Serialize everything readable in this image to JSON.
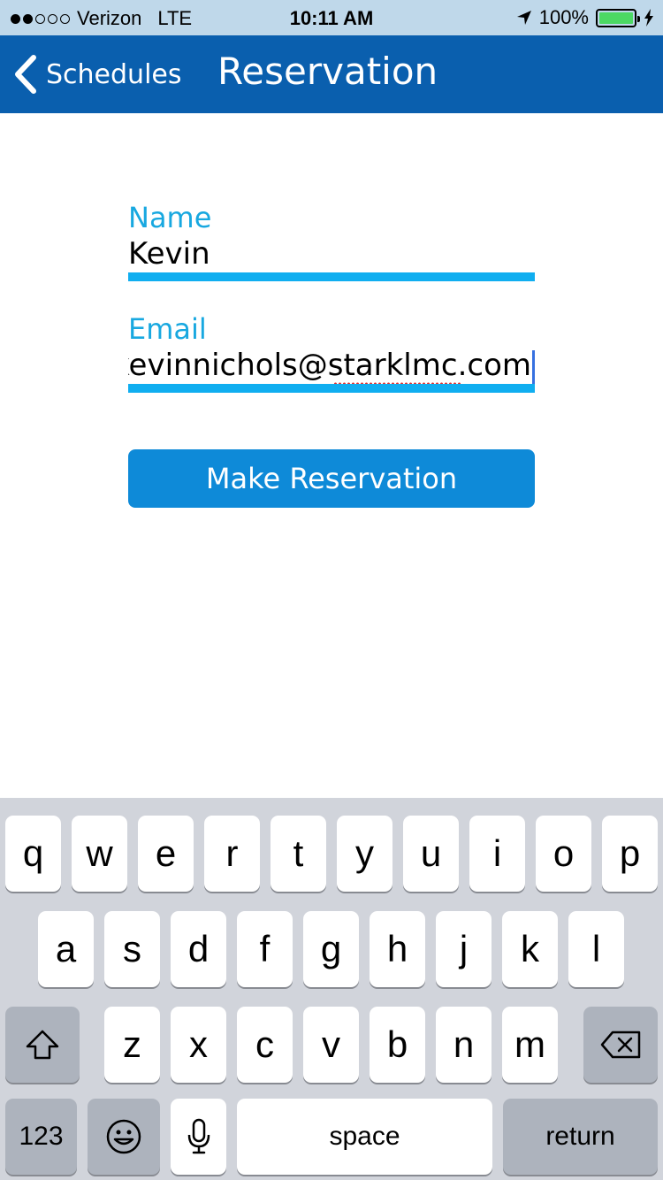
{
  "status_bar": {
    "carrier": "Verizon",
    "network": "LTE",
    "time": "10:11 AM",
    "battery": "100%",
    "signal_bars_filled": 2,
    "signal_bars_total": 5
  },
  "nav": {
    "back_label": "Schedules",
    "title": "Reservation"
  },
  "form": {
    "name_label": "Name",
    "name_value": "Kevin",
    "email_label": "Email",
    "email_value": "kevinnichols@starklmc.com",
    "submit_label": "Make Reservation"
  },
  "keyboard": {
    "row1": [
      "q",
      "w",
      "e",
      "r",
      "t",
      "y",
      "u",
      "i",
      "o",
      "p"
    ],
    "row2": [
      "a",
      "s",
      "d",
      "f",
      "g",
      "h",
      "j",
      "k",
      "l"
    ],
    "row3": [
      "z",
      "x",
      "c",
      "v",
      "b",
      "n",
      "m"
    ],
    "numbers_label": "123",
    "space_label": "space",
    "return_label": "return"
  },
  "colors": {
    "nav_bg": "#0a5fae",
    "status_bg": "#bfd8ea",
    "accent": "#10aef0",
    "button_bg": "#0e8ad8",
    "keyboard_bg": "#d1d4db"
  }
}
